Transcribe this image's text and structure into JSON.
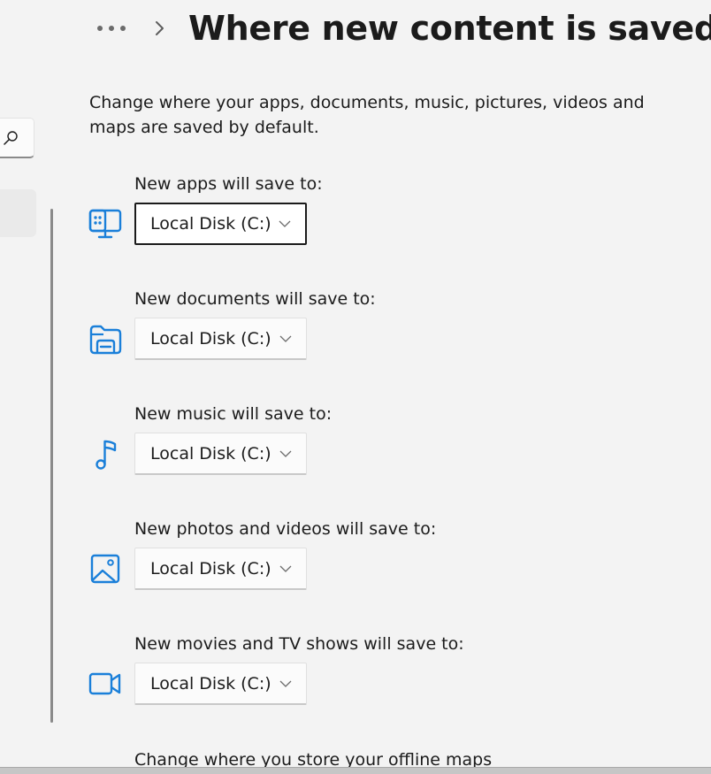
{
  "breadcrumb": {
    "more_icon": "ellipsis-icon",
    "separator_icon": "chevron-right-icon"
  },
  "page": {
    "title": "Where new content is saved",
    "description": "Change where your apps, documents, music, pictures, videos and maps are saved by default."
  },
  "sidebar": {
    "search_icon": "search-icon"
  },
  "colors": {
    "accent": "#0f6cbd",
    "icon_blue": "#1a7fd9",
    "text": "#1b1b1b",
    "background": "#f3f3f3"
  },
  "settings": [
    {
      "label": "New apps will save to:",
      "icon": "app-monitor-icon",
      "value": "Local Disk (C:)",
      "focused": true
    },
    {
      "label": "New documents will save to:",
      "icon": "folder-drive-icon",
      "value": "Local Disk (C:)",
      "focused": false
    },
    {
      "label": "New music will save to:",
      "icon": "music-note-icon",
      "value": "Local Disk (C:)",
      "focused": false
    },
    {
      "label": "New photos and videos will save to:",
      "icon": "image-icon",
      "value": "Local Disk (C:)",
      "focused": false
    },
    {
      "label": "New movies and TV shows will save to:",
      "icon": "video-camera-icon",
      "value": "Local Disk (C:)",
      "focused": false
    }
  ],
  "maps": {
    "label": "Change where you store your offline maps"
  }
}
